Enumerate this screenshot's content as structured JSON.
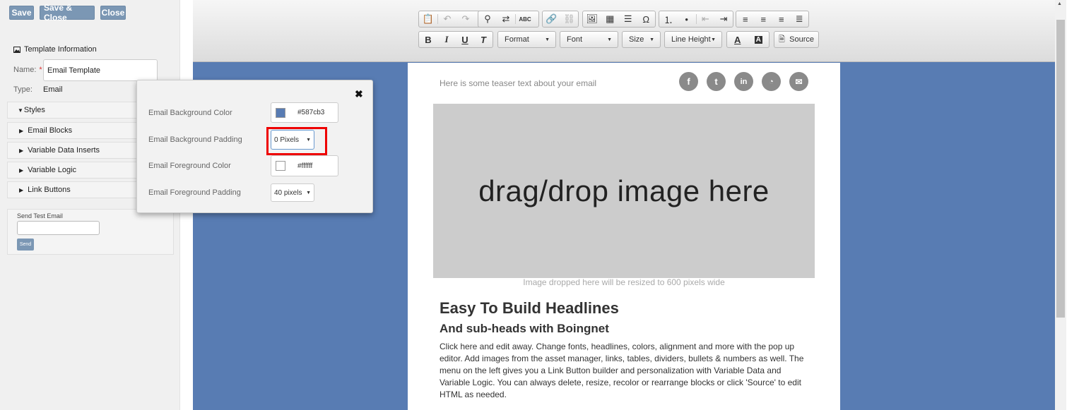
{
  "toolbar_buttons": {
    "save": "Save",
    "save_close": "Save & Close",
    "close": "Close"
  },
  "template_info": {
    "title": "Template Information",
    "name_label": "Name:",
    "required": "*",
    "name_value": "Email Template",
    "type_label": "Type:",
    "type_value": "Email"
  },
  "accordion": {
    "styles": "Styles",
    "email_blocks": "Email Blocks",
    "variable_data": "Variable Data Inserts",
    "variable_logic": "Variable Logic",
    "link_buttons": "Link Buttons"
  },
  "test_email": {
    "label": "Send Test Email",
    "input_value": "",
    "send": "Send"
  },
  "editor": {
    "format": "Format",
    "font": "Font",
    "size": "Size",
    "line_height": "Line Height",
    "source": "Source"
  },
  "email": {
    "teaser": "Here is some teaser text about your email",
    "social_icons": [
      "facebook-icon",
      "tumblr-icon",
      "linkedin-icon",
      "rss-icon",
      "mail-icon"
    ],
    "image_placeholder": "drag/drop image here",
    "image_caption": "Image dropped here will be resized to 600 pixels wide",
    "headline": "Easy To Build Headlines",
    "subhead": "And sub-heads with Boingnet",
    "body": "Click here and edit away. Change fonts, headlines, colors, alignment and more with the pop up editor. Add images from the asset manager, links, tables, dividers, bullets & numbers as well. The menu on the left gives you a Link Button builder and personalization with Variable Data and Variable Logic. You can always delete, resize, recolor or rearrange blocks or click 'Source' to edit HTML as needed."
  },
  "styles_popup": {
    "bg_color_label": "Email Background Color",
    "bg_color_value": "#587cb3",
    "bg_padding_label": "Email Background Padding",
    "bg_padding_value": "0 Pixels",
    "fg_color_label": "Email Foreground Color",
    "fg_color_value": "#ffffff",
    "fg_padding_label": "Email Foreground Padding",
    "fg_padding_value": "40 pixels"
  },
  "colors": {
    "canvas_bg": "#587cb3",
    "button_bg": "#7b97b4",
    "highlight": "#e00000"
  }
}
